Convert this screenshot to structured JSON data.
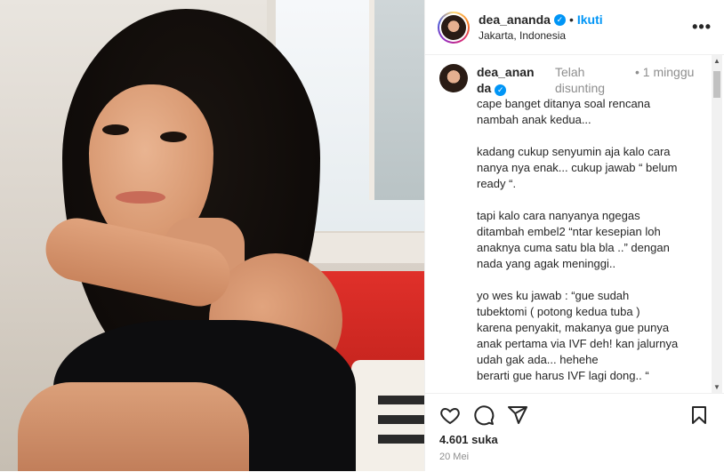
{
  "header": {
    "username": "dea_ananda",
    "separator": "•",
    "follow_label": "Ikuti",
    "location": "Jakarta, Indonesia",
    "more_icon": "more-horizontal-icon"
  },
  "caption": {
    "username": "dea_ananda",
    "edited": "Telah disunting",
    "separator": "•",
    "time": "1 minggu",
    "lines": [
      "cape banget ditanya soal rencana",
      "nambah anak kedua...",
      "",
      "kadang cukup senyumin aja kalo cara",
      "nanya nya enak... cukup jawab “ belum",
      "ready “.",
      "",
      "tapi kalo cara nanyanya ngegas",
      "ditambah embel2 “ntar kesepian loh",
      "anaknya cuma satu bla bla ..” dengan",
      "nada yang agak meninggi..",
      "",
      "yo wes ku jawab : “gue sudah",
      "tubektomi ( potong kedua tuba )",
      "karena penyakit, makanya gue punya",
      "anak pertama via IVF deh! kan jalurnya",
      "udah gak ada... hehehe",
      "berarti gue harus IVF lagi dong.. “"
    ]
  },
  "actions": {
    "like_icon": "heart-icon",
    "comment_icon": "comment-icon",
    "share_icon": "send-icon",
    "save_icon": "bookmark-icon"
  },
  "likes": "4.601 suka",
  "date": "20 Mei",
  "colors": {
    "accent": "#0095f6",
    "text": "#262626",
    "muted": "#8e8e8e"
  }
}
